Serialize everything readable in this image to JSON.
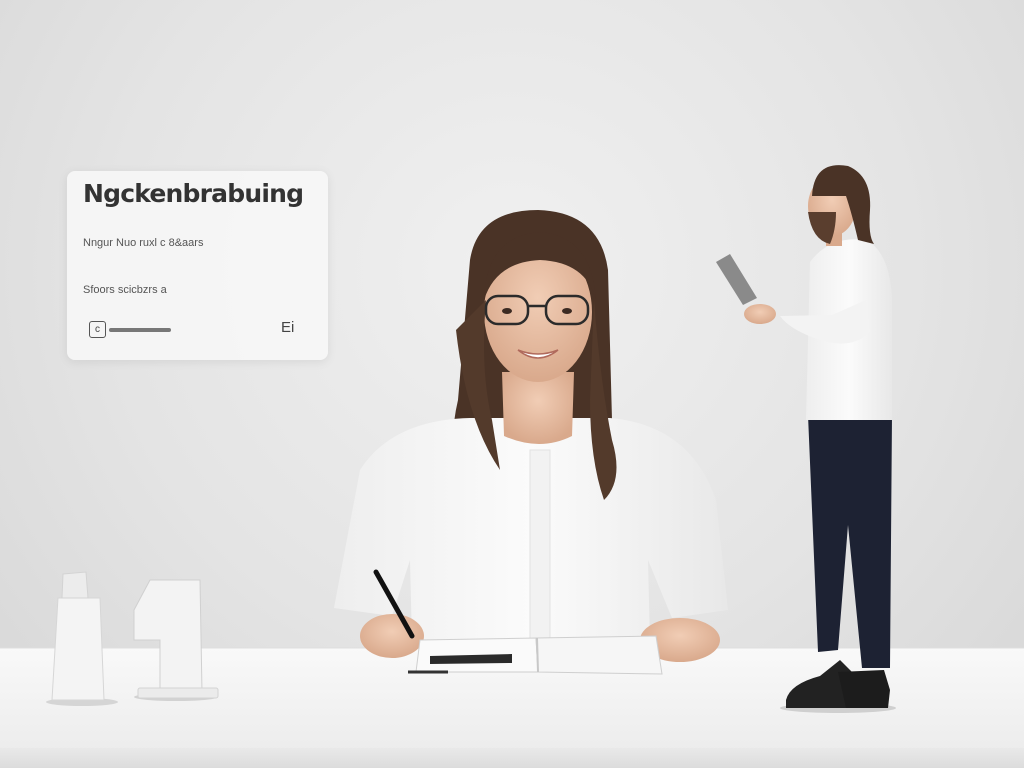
{
  "info_card": {
    "title": "Ngckenbrabuing",
    "line_1": "Nngur Nuo ruxl c 8&aars",
    "line_2": "Sfoors scicbzrs a",
    "footer_left_icon": "c",
    "footer_right_icon": "Ei"
  },
  "scene": {
    "background_color": "#e6e6e6",
    "desk_color": "#f7f7f7",
    "shirt_color": "#f9f9f9",
    "trousers_color": "#1d2233",
    "hair_color": "#4a3326"
  }
}
